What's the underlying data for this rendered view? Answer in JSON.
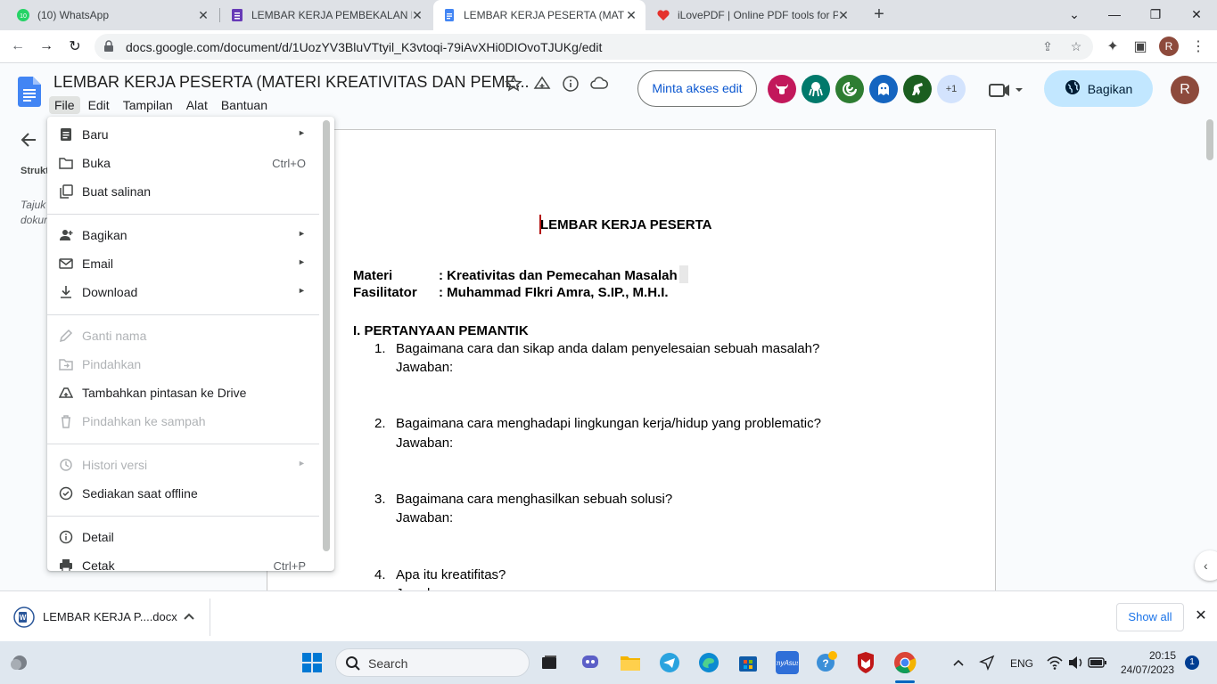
{
  "browser": {
    "tabs": [
      {
        "title": "(10) WhatsApp",
        "icon": "whatsapp-icon",
        "color": "#25d366"
      },
      {
        "title": "LEMBAR KERJA PEMBEKALAN MA",
        "icon": "forms-icon",
        "color": "#673ab7"
      },
      {
        "title": "LEMBAR KERJA PESERTA (MATERI",
        "icon": "docs-icon",
        "color": "#4285f4"
      },
      {
        "title": "iLovePDF | Online PDF tools for P",
        "icon": "ilovepdf-icon",
        "color": "#e5322d"
      }
    ],
    "url": "docs.google.com/document/d/1UozYV3BluVTtyil_K3vtoqi-79iAvXHi0DIOvoTJUKg/edit",
    "profile_initial": "R"
  },
  "docs": {
    "title": "LEMBAR KERJA PESERTA (MATERI KREATIVITAS DAN PEME...",
    "menu": [
      "File",
      "Edit",
      "Tampilan",
      "Alat",
      "Bantuan"
    ],
    "request_access": "Minta akses edit",
    "avatars_more": "+1",
    "share_label": "Bagikan",
    "user_initial": "R",
    "outline_label": "Strukt",
    "outline_hint": "Tajuk dokum"
  },
  "file_menu": {
    "items": [
      {
        "label": "Baru",
        "icon": "document-icon",
        "submenu": true,
        "shortcut": "",
        "disabled": false
      },
      {
        "label": "Buka",
        "icon": "folder-icon",
        "submenu": false,
        "shortcut": "Ctrl+O",
        "disabled": false
      },
      {
        "label": "Buat salinan",
        "icon": "copy-icon",
        "submenu": false,
        "shortcut": "",
        "disabled": false
      },
      {
        "label": "Bagikan",
        "icon": "person-add-icon",
        "submenu": true,
        "shortcut": "",
        "disabled": false
      },
      {
        "label": "Email",
        "icon": "mail-icon",
        "submenu": true,
        "shortcut": "",
        "disabled": false
      },
      {
        "label": "Download",
        "icon": "download-icon",
        "submenu": true,
        "shortcut": "",
        "disabled": false
      },
      {
        "label": "Ganti nama",
        "icon": "rename-icon",
        "submenu": false,
        "shortcut": "",
        "disabled": true
      },
      {
        "label": "Pindahkan",
        "icon": "move-icon",
        "submenu": false,
        "shortcut": "",
        "disabled": true
      },
      {
        "label": "Tambahkan pintasan ke Drive",
        "icon": "drive-shortcut-icon",
        "submenu": false,
        "shortcut": "",
        "disabled": false
      },
      {
        "label": "Pindahkan ke sampah",
        "icon": "trash-icon",
        "submenu": false,
        "shortcut": "",
        "disabled": true
      },
      {
        "label": "Histori versi",
        "icon": "history-icon",
        "submenu": true,
        "shortcut": "",
        "disabled": true
      },
      {
        "label": "Sediakan saat offline",
        "icon": "offline-icon",
        "submenu": false,
        "shortcut": "",
        "disabled": false
      },
      {
        "label": "Detail",
        "icon": "info-icon",
        "submenu": false,
        "shortcut": "",
        "disabled": false
      },
      {
        "label": "Cetak",
        "icon": "print-icon",
        "submenu": false,
        "shortcut": "Ctrl+P",
        "disabled": false
      }
    ]
  },
  "document": {
    "heading": "LEMBAR KERJA PESERTA",
    "materi_key": "Materi",
    "materi_val": ": Kreativitas dan Pemecahan Masalah",
    "fasilitator_key": "Fasilitator",
    "fasilitator_val": ": Muhammad FIkri Amra, S.IP., M.H.I.",
    "section": "I. PERTANYAAN PEMANTIK",
    "questions": [
      {
        "num": "1.",
        "text": "Bagaimana cara dan sikap anda dalam penyelesaian sebuah masalah?",
        "answer": "Jawaban:"
      },
      {
        "num": "2.",
        "text": "Bagaimana cara menghadapi lingkungan kerja/hidup yang problematic?",
        "answer": "Jawaban:"
      },
      {
        "num": "3.",
        "text": "Bagaimana cara menghasilkan sebuah solusi?",
        "answer": "Jawaban:"
      },
      {
        "num": "4.",
        "text": "Apa itu kreatifitas?",
        "answer": "Jawaban:"
      }
    ]
  },
  "downloads": {
    "file_name": "LEMBAR KERJA P....docx",
    "show_all": "Show all"
  },
  "taskbar": {
    "search_label": "Search",
    "lang": "ENG",
    "time": "20:15",
    "date": "24/07/2023",
    "notification_count": "1"
  }
}
